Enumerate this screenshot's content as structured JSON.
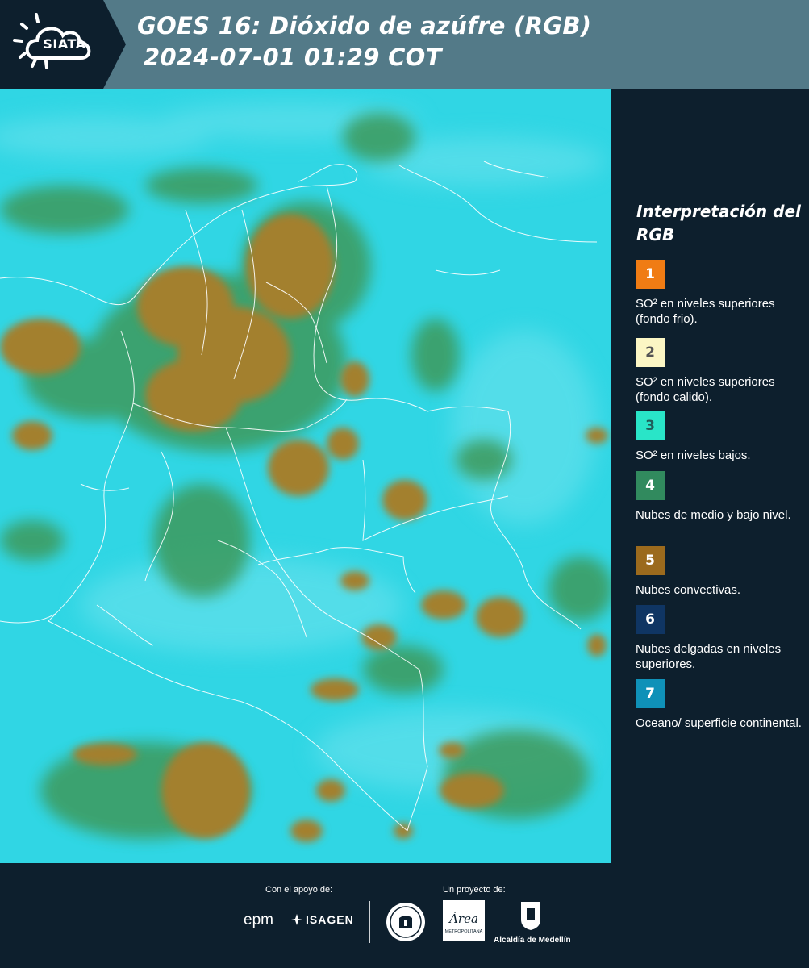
{
  "header": {
    "logo_text": "SIATA",
    "title_line1": "GOES 16: Dióxido de azúfre (RGB)",
    "title_line2": "2024-07-01 01:29 COT",
    "bar_color": "#537a88",
    "logo_bg": "#0d1f2d"
  },
  "map": {
    "colors": {
      "ocean_surface": "#30d6e4",
      "convective_clouds": "#a3802f",
      "mid_low_clouds": "#3e9a5c",
      "borders": "#ffffff"
    }
  },
  "legend": {
    "title": "Interpretación del RGB",
    "items": [
      {
        "number": "1",
        "label": "SO² en niveles superiores (fondo frio).",
        "color": "#f07c14",
        "text_color": "#ffffff"
      },
      {
        "number": "2",
        "label": "SO² en niveles superiores (fondo calido).",
        "color": "#fbf6c4",
        "text_color": "#555555"
      },
      {
        "number": "3",
        "label": "SO² en niveles bajos.",
        "color": "#29e5c8",
        "text_color": "#1f5f5a"
      },
      {
        "number": "4",
        "label": "Nubes de medio y bajo nivel.",
        "color": "#318a5e",
        "text_color": "#ffffff"
      },
      {
        "number": "5",
        "label": "Nubes convectivas.",
        "color": "#9b6a1d",
        "text_color": "#ffffff"
      },
      {
        "number": "6",
        "label": "Nubes delgadas en niveles superiores.",
        "color": "#0f3563",
        "text_color": "#ffffff"
      },
      {
        "number": "7",
        "label": "Oceano/ superficie continental.",
        "color": "#0f91b8",
        "text_color": "#ffffff"
      }
    ]
  },
  "footer": {
    "support_label": "Con el apoyo de:",
    "project_label": "Un proyecto de:",
    "sponsors": [
      "epm",
      "ISAGEN"
    ],
    "partners": [
      "Área Metropolitana Valle de Aburrá",
      "Alcaldía de Medellín"
    ],
    "area_logo_text": "Área",
    "area_logo_sub": "METROPOLITANA",
    "alcaldia_text": "Alcaldía de Medellín"
  }
}
